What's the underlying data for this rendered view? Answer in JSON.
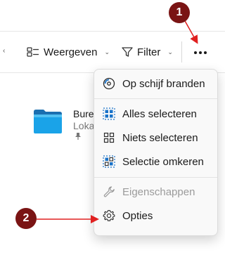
{
  "toolbar": {
    "view_label": "Weergeven",
    "filter_label": "Filter"
  },
  "file": {
    "name": "Bureau",
    "location": "Loka"
  },
  "menu": {
    "items": [
      {
        "label": "Op schijf branden",
        "icon": "disc-burn-icon",
        "enabled": true
      },
      {
        "label": "Alles selecteren",
        "icon": "select-all-icon",
        "enabled": true
      },
      {
        "label": "Niets selecteren",
        "icon": "select-none-icon",
        "enabled": true
      },
      {
        "label": "Selectie omkeren",
        "icon": "invert-selection-icon",
        "enabled": true
      },
      {
        "label": "Eigenschappen",
        "icon": "wrench-icon",
        "enabled": false
      },
      {
        "label": "Opties",
        "icon": "gear-icon",
        "enabled": true
      }
    ]
  },
  "annotations": {
    "badge_1": "1",
    "badge_2": "2",
    "color": "#7a1414",
    "arrow_color": "#e02020"
  }
}
